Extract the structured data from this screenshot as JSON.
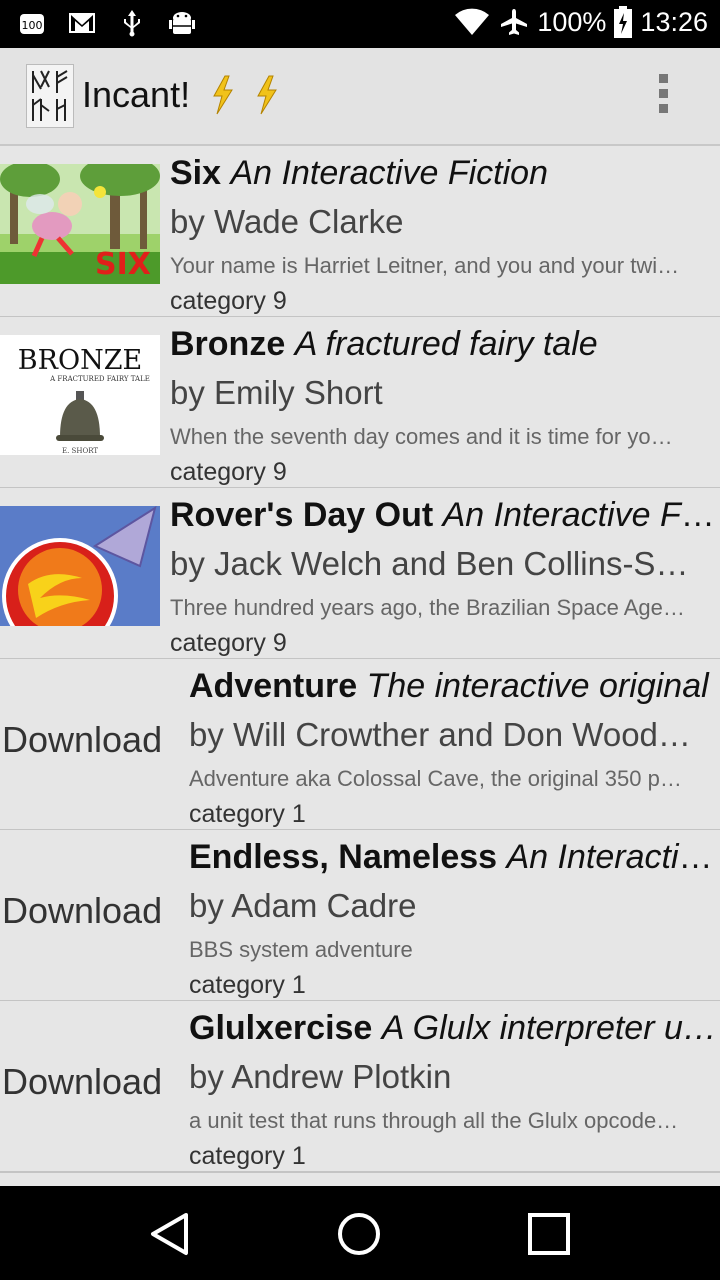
{
  "status_bar": {
    "battery": "100%",
    "time": "13:26",
    "icons": [
      "notification-100-icon",
      "gmail-icon",
      "usb-icon",
      "android-debug-icon",
      "wifi-icon",
      "airplane-icon",
      "battery-charging-icon"
    ]
  },
  "app_bar": {
    "title": "Incant!",
    "icons": [
      "app-logo-icon",
      "lightning-icon",
      "lightning-icon",
      "overflow-menu-icon"
    ]
  },
  "stories": [
    {
      "title": "Six",
      "subtitle": "An Interactive Fiction",
      "author": "by Wade Clarke",
      "blurb": "Your name is Harriet Leitner, and you and your twi…",
      "category": "category 9",
      "cover": "six-cover"
    },
    {
      "title": "Bronze",
      "subtitle": "A fractured fairy tale",
      "author": "by Emily Short",
      "blurb": "When the seventh day comes and it is time for yo…",
      "category": "category 9",
      "cover": "bronze-cover",
      "cover_text": "BRONZE",
      "cover_sub": "A FRACTURED FAIRY TALE",
      "cover_author": "E. SHORT"
    },
    {
      "title": "Rover's Day Out",
      "subtitle": "An Interactive Fic…",
      "author": "by Jack Welch and Ben Collins-S…",
      "blurb": "Three hundred years ago, the Brazilian Space Age…",
      "category": "category 9",
      "cover": "rover-cover"
    },
    {
      "title": "Adventure",
      "subtitle": "The interactive original",
      "author": "by Will Crowther and Don Wood…",
      "blurb": "Adventure aka Colossal Cave, the original 350 p…",
      "category": "category 1",
      "download_label": "Download"
    },
    {
      "title": "Endless, Nameless",
      "subtitle": "An Interactiv…",
      "author": "by Adam Cadre",
      "blurb": "BBS system adventure",
      "category": "category 1",
      "download_label": "Download"
    },
    {
      "title": "Glulxercise",
      "subtitle": "A Glulx interpreter u…",
      "author": "by Andrew Plotkin",
      "blurb": "a unit test that runs through all the Glulx opcode…",
      "category": "category 1",
      "download_label": "Download"
    }
  ],
  "nav_bar": {
    "icons": [
      "back-icon",
      "home-icon",
      "recents-icon"
    ]
  }
}
